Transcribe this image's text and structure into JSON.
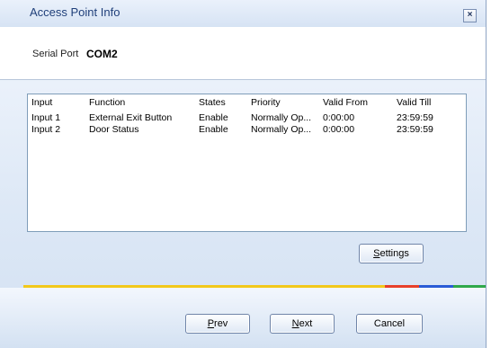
{
  "window": {
    "title": "Access Point Info",
    "close_label": "×"
  },
  "serial": {
    "label": "Serial Port",
    "value": "COM2"
  },
  "table": {
    "columns": [
      "Input",
      "Function",
      "States",
      "Priority",
      "Valid From",
      "Valid Till"
    ],
    "rows": [
      [
        "Input 1",
        "External Exit Button",
        "Enable",
        "Normally Op...",
        "0:00:00",
        "23:59:59"
      ],
      [
        "Input 2",
        "Door Status",
        "Enable",
        "Normally Op...",
        "0:00:00",
        "23:59:59"
      ]
    ]
  },
  "buttons": {
    "settings": {
      "accel": "S",
      "rest": "ettings"
    },
    "prev": {
      "accel": "P",
      "rest": "rev"
    },
    "next": {
      "accel": "N",
      "rest": "ext"
    },
    "cancel": "Cancel"
  },
  "colors": {
    "line_yellow": "#f2c81a",
    "line_red": "#e8402a",
    "line_blue": "#2a5bd6",
    "line_green": "#2fa84a"
  }
}
